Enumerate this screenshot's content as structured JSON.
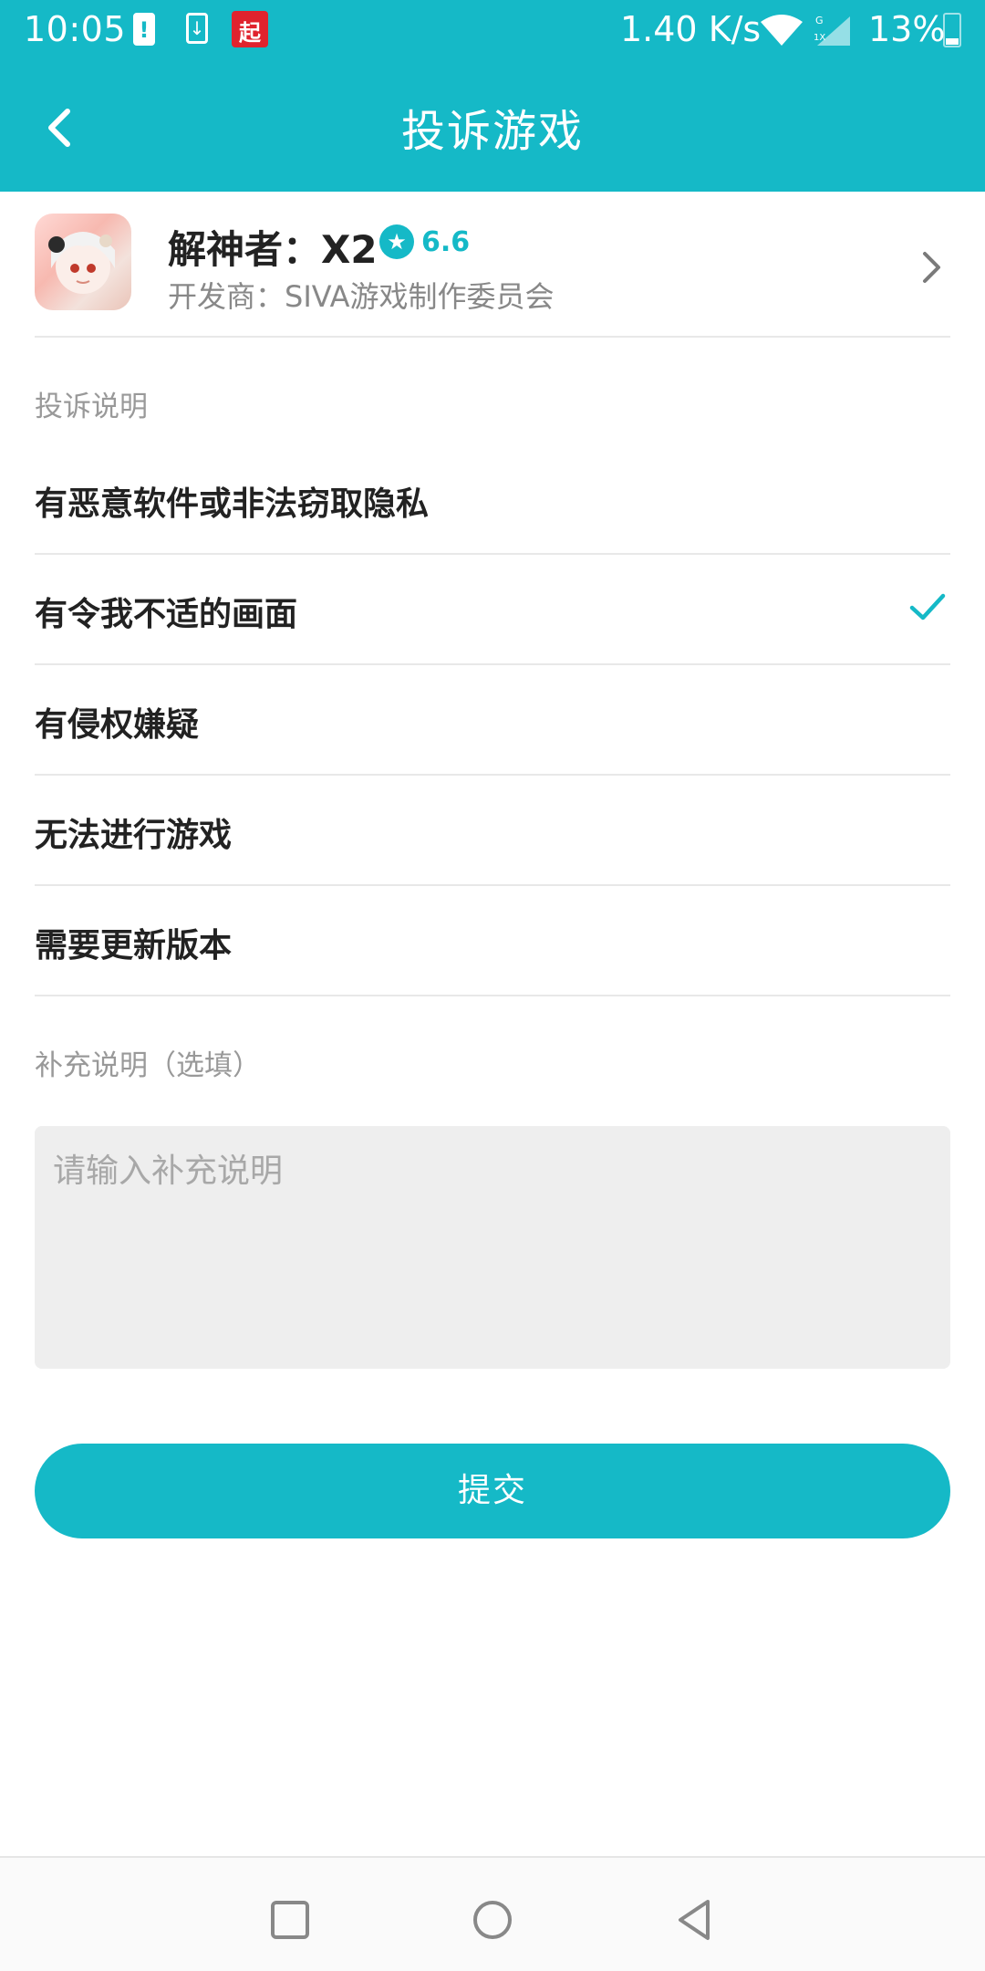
{
  "status_bar": {
    "time": "10:05",
    "app_badge": "起",
    "network_speed": "1.40 K/s",
    "battery_percent": "13%",
    "icons": [
      "alert-icon",
      "download-icon",
      "app-notification-icon",
      "wifi-icon",
      "signal-icon",
      "battery-icon"
    ]
  },
  "toolbar": {
    "title": "投诉游戏",
    "back_icon": "back-arrow-icon"
  },
  "game": {
    "name": "解神者：X2",
    "rating": "6.6",
    "developer": "开发商：SIVA游戏制作委员会"
  },
  "complaint": {
    "section_title": "投诉说明",
    "reasons": [
      {
        "label": "有恶意软件或非法窃取隐私",
        "selected": false
      },
      {
        "label": "有令我不适的画面",
        "selected": true
      },
      {
        "label": "有侵权嫌疑",
        "selected": false
      },
      {
        "label": "无法进行游戏",
        "selected": false
      },
      {
        "label": "需要更新版本",
        "selected": false
      }
    ]
  },
  "supplement": {
    "section_title": "补充说明（选填）",
    "placeholder": "请输入补充说明",
    "value": ""
  },
  "submit": {
    "label": "提交"
  },
  "colors": {
    "accent": "#15b9c7",
    "text_primary": "#222222",
    "text_secondary": "#999999",
    "divider": "#e8e8e8",
    "input_bg": "#eeeeee"
  }
}
